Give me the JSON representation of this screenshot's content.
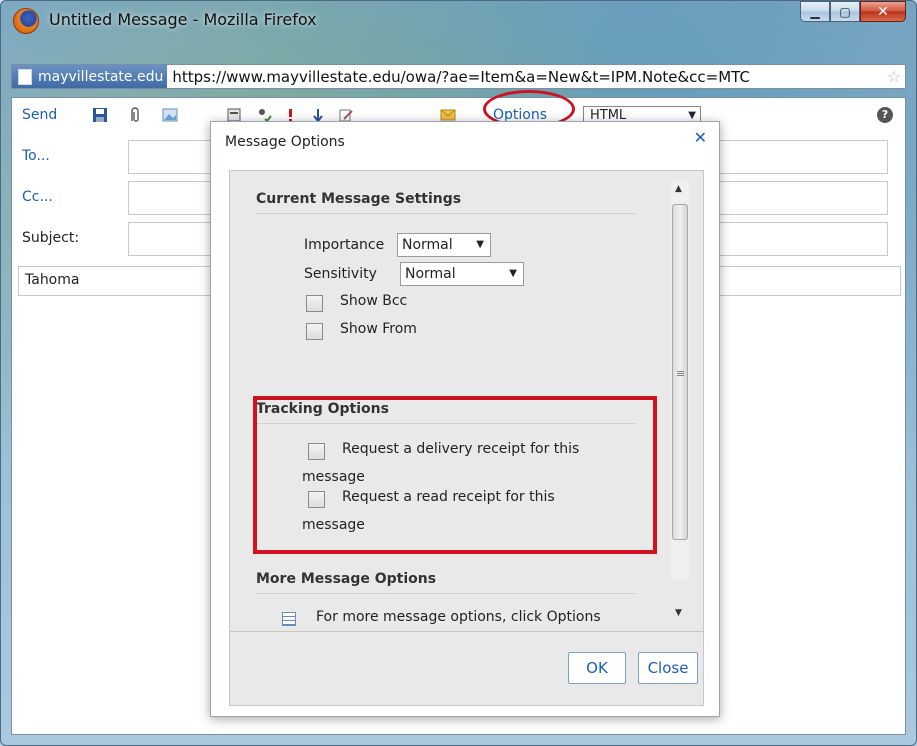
{
  "window": {
    "title": "Untitled Message - Mozilla Firefox",
    "controls": [
      "minimize",
      "maximize",
      "close"
    ]
  },
  "addressbar": {
    "site_identity": "mayvillestate.edu",
    "url": "https://www.mayvillestate.edu/owa/?ae=Item&a=New&t=IPM.Note&cc=MTC"
  },
  "toolbar": {
    "send_label": "Send",
    "options_label": "Options",
    "format_value": "HTML",
    "icons": [
      "save-icon",
      "attach-icon",
      "image-icon",
      "addressbook-icon",
      "check-names-icon",
      "importance-high-icon",
      "importance-low-icon",
      "signature-icon",
      "flag-icon"
    ]
  },
  "compose": {
    "to_label": "To...",
    "cc_label": "Cc...",
    "subject_label": "Subject:",
    "font_name": "Tahoma"
  },
  "dialog": {
    "title": "Message Options",
    "current_settings": {
      "heading": "Current Message Settings",
      "importance_label": "Importance",
      "importance_value": "Normal",
      "sensitivity_label": "Sensitivity",
      "sensitivity_value": "Normal",
      "show_bcc_label": "Show Bcc",
      "show_from_label": "Show From"
    },
    "tracking": {
      "heading": "Tracking Options",
      "delivery_receipt_line1": "Request a delivery receipt for this",
      "delivery_receipt_line2": "message",
      "read_receipt_line1": "Request a read receipt for this",
      "read_receipt_line2": "message"
    },
    "more": {
      "heading": "More Message Options",
      "text": "For more message options, click Options"
    },
    "ok_label": "OK",
    "close_label": "Close"
  },
  "colors": {
    "link_blue": "#1a5fb4",
    "highlight_red": "#d0121e"
  }
}
